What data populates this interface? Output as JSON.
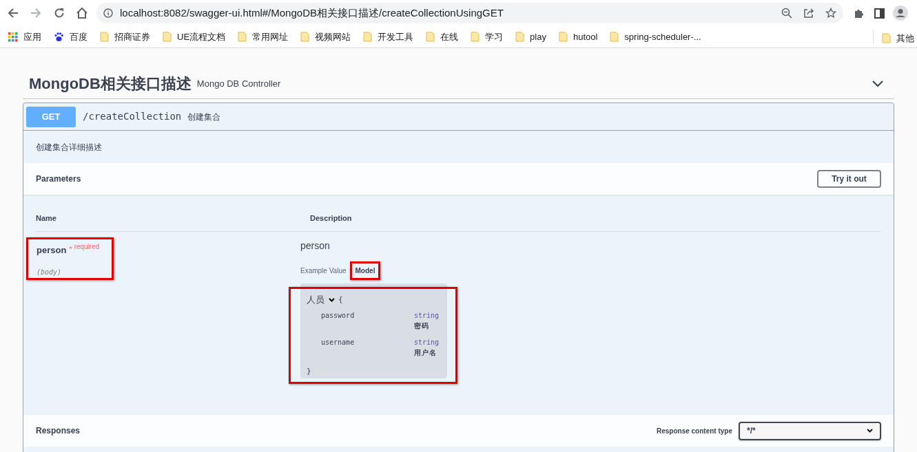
{
  "browser": {
    "url": "localhost:8082/swagger-ui.html#/MongoDB相关接口描述/createCollectionUsingGET",
    "bookmarks": [
      {
        "kind": "apps",
        "label": "应用"
      },
      {
        "kind": "paw",
        "label": "百度"
      },
      {
        "kind": "folder",
        "label": "招商证券"
      },
      {
        "kind": "folder",
        "label": "UE流程文档"
      },
      {
        "kind": "folder",
        "label": "常用网址"
      },
      {
        "kind": "folder",
        "label": "视频网站"
      },
      {
        "kind": "folder",
        "label": "开发工具"
      },
      {
        "kind": "folder",
        "label": "在线"
      },
      {
        "kind": "folder",
        "label": "学习"
      },
      {
        "kind": "folder",
        "label": "play"
      },
      {
        "kind": "folder",
        "label": "hutool"
      },
      {
        "kind": "folder",
        "label": "spring-scheduler-..."
      }
    ],
    "other_bookmarks": "其他"
  },
  "tag": {
    "title": "MongoDB相关接口描述",
    "subtitle": "Mongo DB Controller",
    "expanded": true
  },
  "operation": {
    "method": "GET",
    "path": "/createCollection",
    "summary": "创建集合",
    "description": "创建集合详细描述",
    "parameters": {
      "title": "Parameters",
      "try_button": "Try it out",
      "columns": [
        "Name",
        "Description"
      ],
      "rows": [
        {
          "name": "person",
          "required_mark": "*",
          "required": "required",
          "location": "(body)",
          "highlighted": true,
          "description": "person",
          "tabs": [
            {
              "label": "Example Value",
              "selected": false,
              "highlighted": false
            },
            {
              "label": "Model",
              "selected": true,
              "highlighted": true
            }
          ],
          "model": {
            "title": "人员",
            "expanded": true,
            "open": "{",
            "close": "}",
            "highlighted": true,
            "properties": [
              {
                "name": "password",
                "type": "string",
                "description": "密码"
              },
              {
                "name": "username",
                "type": "string",
                "description": "用户名"
              }
            ]
          }
        }
      ]
    },
    "responses": {
      "title": "Responses",
      "content_type_label": "Response content type",
      "content_type": "*/*"
    }
  }
}
